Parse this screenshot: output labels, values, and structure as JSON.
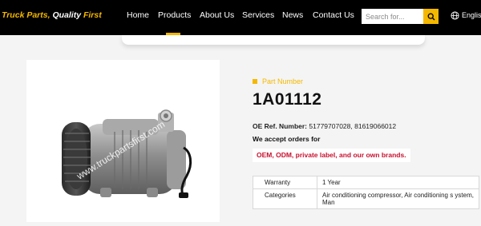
{
  "header": {
    "logo_main": "Truck Parts,",
    "logo_accent": "Quality",
    "logo_end": "First",
    "nav": [
      {
        "label": "Home"
      },
      {
        "label": "Products"
      },
      {
        "label": "About Us"
      },
      {
        "label": "Services"
      },
      {
        "label": "News"
      },
      {
        "label": "Contact Us"
      }
    ],
    "active_nav": "Products",
    "search": {
      "placeholder": "Search for..."
    },
    "language": "English"
  },
  "product": {
    "watermark": "www.truckpartsfirst.com",
    "part_number_label": "Part Number",
    "part_number": "1A01112",
    "oe_label": "OE Ref. Number:",
    "oe_value": "51779707028, 81619066012",
    "accept_text": "We accept orders for",
    "oem_text": "OEM, ODM, private label, and our own brands.",
    "specs": [
      {
        "key": "Warranty",
        "value": "1 Year"
      },
      {
        "key": "Categories",
        "value": "Air conditioning compressor, Air conditioning s ystem, Man"
      }
    ]
  },
  "colors": {
    "accent": "#f5b800",
    "header_bg": "#000000",
    "oem_red": "#c8102e"
  }
}
